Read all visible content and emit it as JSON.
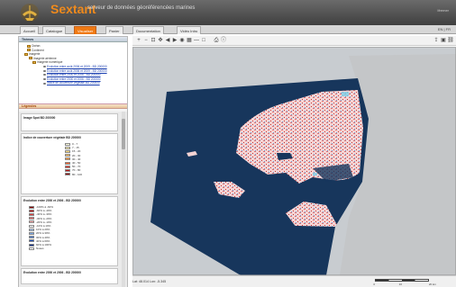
{
  "header": {
    "title": "Sextant",
    "subtitle": "serveur de données géoréférencées marines",
    "org": "Ifremer",
    "brand_color": "#f08a1c"
  },
  "tabs": [
    {
      "label": "Accueil"
    },
    {
      "label": "Catalogue"
    },
    {
      "label": "Visualiser"
    },
    {
      "label": "Panier"
    },
    {
      "label": "Documentation"
    },
    {
      "label": "Vidéo Intro"
    }
  ],
  "lang": "EN | FR",
  "left_panel": {
    "layers_title": "Thèmes",
    "tree": [
      {
        "label": "Océan",
        "type": "folder"
      },
      {
        "label": "Continent",
        "type": "folder"
      },
      {
        "label": "Imagerie",
        "type": "folder"
      },
      {
        "label": "Imagerie aérienne",
        "type": "folder"
      },
      {
        "label": "Imagerie numérique",
        "type": "folder"
      },
      {
        "label": "Evolution entre août 2006 et 2009 - BD 200000",
        "type": "layer"
      },
      {
        "label": "Evolution entre août 2006 et 2009 - BD 200000",
        "type": "layer"
      },
      {
        "label": "Evolution entre 2000 et 2006 - BD 200000",
        "type": "layer"
      },
      {
        "label": "Evolution entre 2000 et 2006 - BD 200000",
        "type": "layer"
      },
      {
        "label": "Indice de couverture végétale BD 200000",
        "type": "layer"
      }
    ],
    "legend_title": "Légendes",
    "legend_boxes": [
      {
        "title": "Image Spot BD 200000",
        "items": []
      },
      {
        "title": "Indice de couverture végétale BD 200000",
        "items": [
          {
            "label": "0 - 7",
            "color": "#ffffe0"
          },
          {
            "label": "7 - 15",
            "color": "#fff4b0"
          },
          {
            "label": "15 - 20",
            "color": "#ffe080"
          },
          {
            "label": "20 - 30",
            "color": "#ffc060"
          },
          {
            "label": "30 - 40",
            "color": "#ff9a40"
          },
          {
            "label": "40 - 50",
            "color": "#ff6a30"
          },
          {
            "label": "50 - 70",
            "color": "#e83020"
          },
          {
            "label": "70 - 80",
            "color": "#c01818"
          },
          {
            "label": "80 - 100",
            "color": "#8a0a0a"
          }
        ]
      },
      {
        "title": "Evolution entre 2000 et 2006 - BD 200000",
        "items": [
          {
            "label": "-100% à -60%",
            "color": "#8a0000"
          },
          {
            "label": "-60% à -40%",
            "color": "#c01010"
          },
          {
            "label": "-40% à -30%",
            "color": "#e04040"
          },
          {
            "label": "-30% à -20%",
            "color": "#f07070"
          },
          {
            "label": "-20% à -10%",
            "color": "#f7a8a8"
          },
          {
            "label": "-10% à 10%",
            "color": "#ffffff"
          },
          {
            "label": "10% à 20%",
            "color": "#a8c8f0"
          },
          {
            "label": "20% à 30%",
            "color": "#7aa8e8"
          },
          {
            "label": "30% à 40%",
            "color": "#4a80d8"
          },
          {
            "label": "40% à 60%",
            "color": "#2050b8"
          },
          {
            "label": "60% à 100%",
            "color": "#0a2a88"
          },
          {
            "label": "Nuées",
            "color": "#ffffff"
          }
        ]
      },
      {
        "title": "Evolution entre 2000 et 2006 - BD 200000",
        "items": []
      }
    ]
  },
  "status": {
    "coords": "Lat: 48.014 Lon: -5.345",
    "scale_labels": [
      "0",
      "10",
      "20 km"
    ]
  },
  "colors": {
    "sea_dark": "#17365c",
    "land_grey": "#c8ccd0",
    "veg_pink": "#e88e8e",
    "accent": "#f07a14"
  }
}
